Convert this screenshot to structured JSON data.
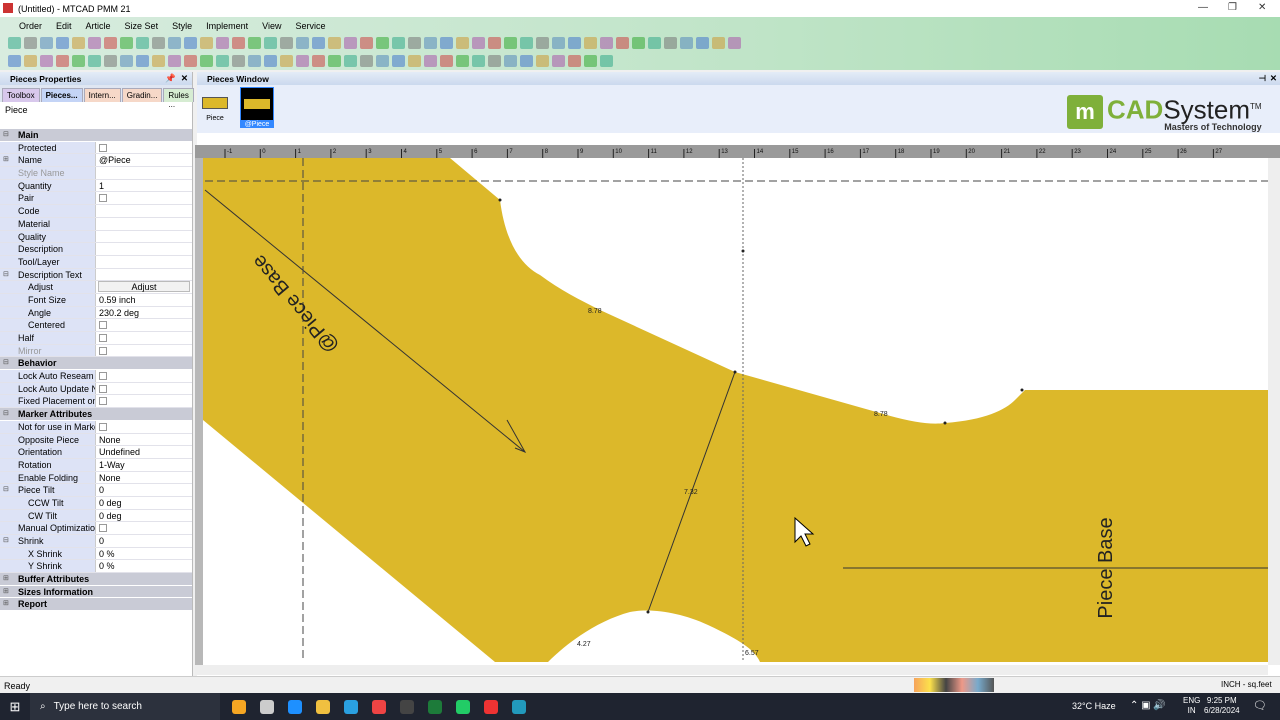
{
  "window": {
    "title": "(Untitled) - MTCAD PMM 21"
  },
  "menu": [
    "Order",
    "Edit",
    "Article",
    "Size Set",
    "Style",
    "Implement",
    "View",
    "Service"
  ],
  "left_panel": {
    "title": "Pieces Properties",
    "tabs": [
      "Toolbox",
      "Pieces...",
      "Intern...",
      "Gradin...",
      "Rules ..."
    ],
    "object_label": "Piece"
  },
  "properties": {
    "main": {
      "label": "Main",
      "rows": [
        {
          "k": "Protected",
          "type": "check"
        },
        {
          "k": "Name",
          "v": "@Piece"
        },
        {
          "k": "Style Name",
          "v": "",
          "dis": true
        },
        {
          "k": "Quantity",
          "v": "1"
        },
        {
          "k": "Pair",
          "type": "check"
        },
        {
          "k": "Code",
          "v": ""
        },
        {
          "k": "Material",
          "v": ""
        },
        {
          "k": "Quality",
          "v": ""
        },
        {
          "k": "Description",
          "v": ""
        },
        {
          "k": "Tool/Layer",
          "v": ""
        },
        {
          "k": "Description Text",
          "v": ""
        },
        {
          "k": "Adjust",
          "v": "Adjust",
          "type": "button",
          "indent": true
        },
        {
          "k": "Font Size",
          "v": "0.59 inch",
          "indent": true
        },
        {
          "k": "Angle",
          "v": "230.2 deg",
          "indent": true
        },
        {
          "k": "Centered",
          "type": "check",
          "indent": true
        },
        {
          "k": "Half",
          "type": "check"
        },
        {
          "k": "Mirror",
          "type": "check",
          "dis": true
        }
      ]
    },
    "behavior": {
      "label": "Behavior",
      "rows": [
        {
          "k": "Lock Auto Reseam",
          "type": "check"
        },
        {
          "k": "Lock Auto Update No",
          "type": "check"
        },
        {
          "k": "Fixed Placement on \\",
          "type": "check"
        }
      ]
    },
    "marker": {
      "label": "Marker Attributes",
      "rows": [
        {
          "k": "Not for use in Marker",
          "type": "check"
        },
        {
          "k": "Opposite Piece",
          "v": "None"
        },
        {
          "k": "Orientation",
          "v": "Undefined"
        },
        {
          "k": "Rotation",
          "v": "1-Way"
        },
        {
          "k": "Enable Folding",
          "v": "None"
        },
        {
          "k": "Piece Tilt",
          "v": "0"
        },
        {
          "k": "CCW Tilt",
          "v": "0 deg",
          "indent": true
        },
        {
          "k": "CW Tilt",
          "v": "0 deg",
          "indent": true
        },
        {
          "k": "Manual Optimization",
          "type": "check"
        },
        {
          "k": "Shrink",
          "v": "0"
        },
        {
          "k": "X Shrink",
          "v": "0 %",
          "indent": true
        },
        {
          "k": "Y Shrink",
          "v": "0 %",
          "indent": true
        }
      ]
    },
    "collapsed": [
      "Buffer Attributes",
      "Sizes Information",
      "Report"
    ]
  },
  "pieces_window": {
    "title": "Pieces Window",
    "thumbs": [
      "Piece",
      "@Piece"
    ]
  },
  "logo": {
    "brand": "CADSystem",
    "tm": "TM",
    "tagline": "Masters of Technology"
  },
  "canvas": {
    "piece_label_1": "@Piece Base",
    "piece_label_2": "Piece Base",
    "measurements": [
      "8.78",
      "8.78",
      "7.32",
      "4.27",
      "6.57"
    ],
    "ruler": [
      "-1",
      "0",
      "1",
      "2",
      "3",
      "4",
      "5",
      "6",
      "7",
      "8",
      "9",
      "10",
      "11",
      "12",
      "13",
      "14",
      "15",
      "16",
      "17",
      "18",
      "19",
      "20",
      "21",
      "22",
      "23",
      "24",
      "25",
      "26",
      "27"
    ],
    "piece_color": "#dcb82a"
  },
  "status": {
    "text": "Ready",
    "units": "INCH - sq.feet"
  },
  "taskbar": {
    "search": "Type here to search",
    "weather": "32°C  Haze",
    "lang1": "ENG",
    "lang2": "IN",
    "time": "9:25 PM",
    "date": "6/28/2024"
  }
}
